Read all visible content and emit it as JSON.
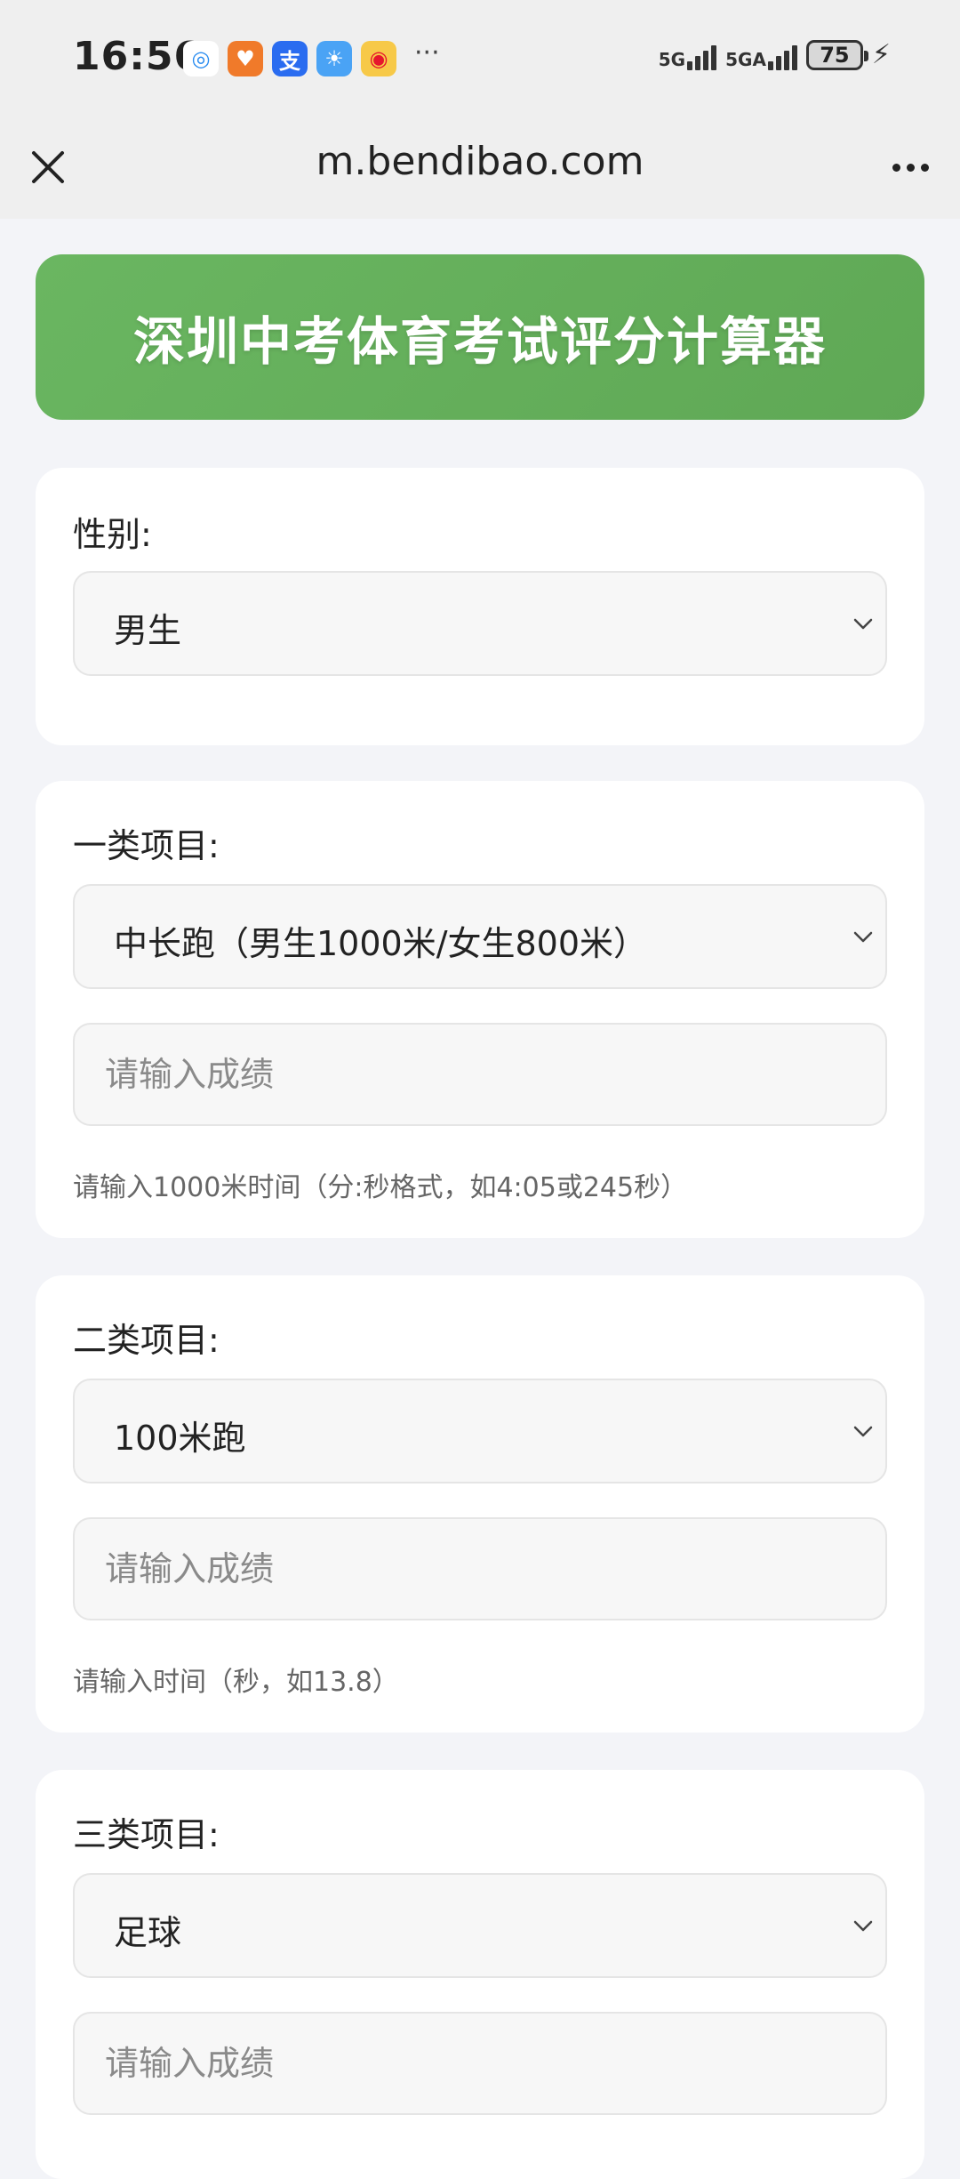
{
  "status_bar": {
    "time": "16:56",
    "notifications": [
      {
        "icon": "chat-bubble-icon",
        "glyph": "◎",
        "color": "#2a8cf0",
        "bg": "#ffffff"
      },
      {
        "icon": "heart-app-icon",
        "glyph": "♥",
        "color": "#ffffff",
        "bg": "#f07a2a"
      },
      {
        "icon": "alipay-icon",
        "glyph": "支",
        "color": "#ffffff",
        "bg": "#2a6cf0"
      },
      {
        "icon": "weather-icon",
        "glyph": "☀",
        "color": "#ffffff",
        "bg": "#4aa3f5"
      },
      {
        "icon": "weibo-icon",
        "glyph": "◉",
        "color": "#e6162d",
        "bg": "#f7c948"
      }
    ],
    "more": "···",
    "network_1": "5G",
    "network_2": "5GA",
    "battery": "75"
  },
  "browser": {
    "url": "m.bendibao.com"
  },
  "banner": {
    "title": "深圳中考体育考试评分计算器"
  },
  "gender_card": {
    "label": "性别:",
    "selected": "男生"
  },
  "category_1": {
    "label": "一类项目:",
    "selected": "中长跑（男生1000米/女生800米）",
    "input_placeholder": "请输入成绩",
    "hint": "请输入1000米时间（分:秒格式，如4:05或245秒）"
  },
  "category_2": {
    "label": "二类项目:",
    "selected": "100米跑",
    "input_placeholder": "请输入成绩",
    "hint": "请输入时间（秒，如13.8）"
  },
  "category_3": {
    "label": "三类项目:",
    "selected": "足球",
    "input_placeholder": "请输入成绩"
  }
}
